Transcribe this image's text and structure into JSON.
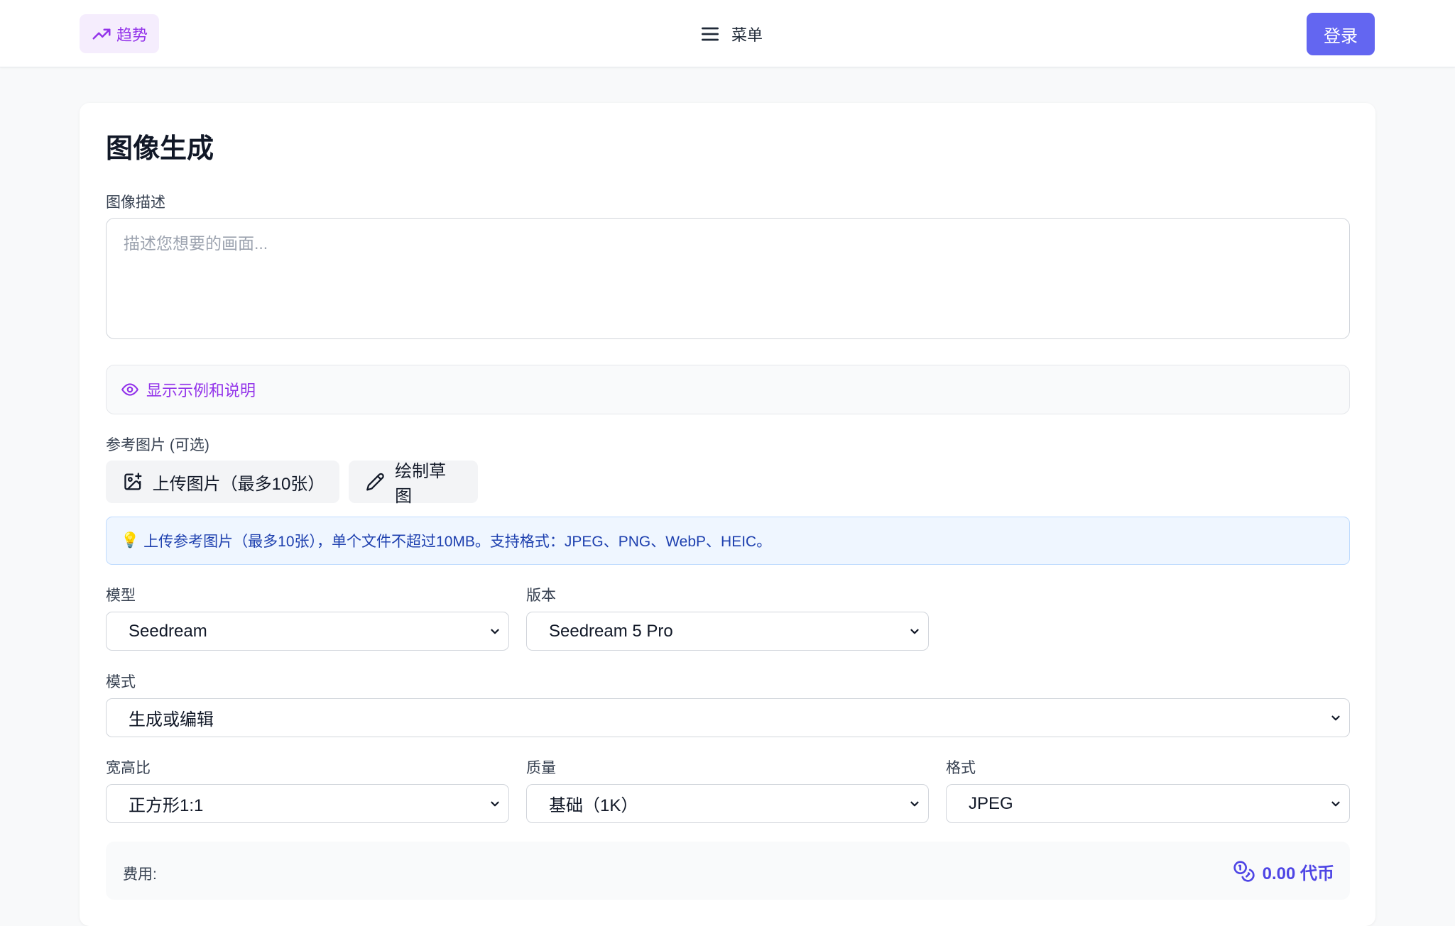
{
  "header": {
    "trend_label": "趋势",
    "menu_label": "菜单",
    "login_label": "登录"
  },
  "page": {
    "title": "图像生成",
    "description_label": "图像描述",
    "description_placeholder": "描述您想要的画面...",
    "examples_toggle": "显示示例和说明",
    "reference_label": "参考图片 (可选)",
    "upload_button": "上传图片（最多10张）",
    "sketch_button": "绘制草图",
    "upload_hint": "上传参考图片（最多10张），单个文件不超过10MB。支持格式：JPEG、PNG、WebP、HEIC。"
  },
  "fields": {
    "model": {
      "label": "模型",
      "value": "Seedream"
    },
    "version": {
      "label": "版本",
      "value": "Seedream 5 Pro"
    },
    "mode": {
      "label": "模式",
      "value": "生成或编辑"
    },
    "aspect": {
      "label": "宽高比",
      "value": "正方形1:1"
    },
    "quality": {
      "label": "质量",
      "value": "基础（1K）"
    },
    "format": {
      "label": "格式",
      "value": "JPEG"
    }
  },
  "cost": {
    "label": "费用:",
    "value": "0.00 代币"
  },
  "icons": {
    "trend": "trending-up-icon",
    "menu": "hamburger-icon",
    "eye": "eye-icon",
    "upload": "image-plus-icon",
    "sketch": "pencil-icon",
    "bulb": "lightbulb-icon",
    "chevron": "chevron-down-icon",
    "coins": "coins-icon"
  },
  "colors": {
    "accent": "#6366f1",
    "purple_text": "#9333ea",
    "info_bg": "#eff6ff",
    "info_text": "#1e40af"
  }
}
